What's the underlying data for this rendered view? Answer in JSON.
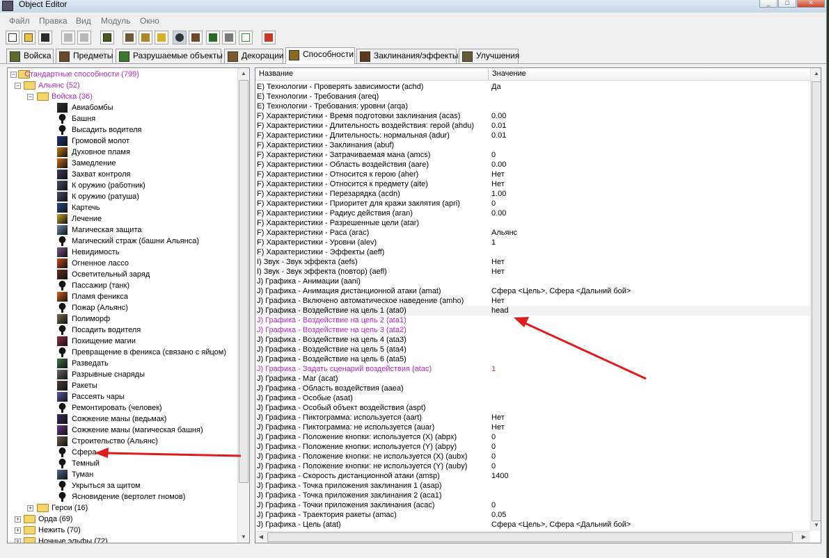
{
  "window": {
    "title": "Object Editor"
  },
  "menu": [
    "Файл",
    "Правка",
    "Вид",
    "Модуль",
    "Окно"
  ],
  "toolbar_icons": [
    "new-file-icon",
    "open-folder-icon",
    "save-icon",
    "copy-icon",
    "paste-icon",
    "unit-icon",
    "doodad-icon",
    "item-icon",
    "sound-icon",
    "ability-icon",
    "upgrade-icon",
    "terrain-icon",
    "object-icon",
    "export-icon",
    "test-map-icon"
  ],
  "tabs": [
    {
      "label": "Войска",
      "icon_color": "#5a6f2a"
    },
    {
      "label": "Предметы",
      "icon_color": "#6b4a2a"
    },
    {
      "label": "Разрушаемые объекты",
      "icon_color": "#3a7a2a"
    },
    {
      "label": "Декорации",
      "icon_color": "#7a5a2a"
    },
    {
      "label": "Способности",
      "icon_color": "#8a6a20",
      "active": true
    },
    {
      "label": "Заклинания/эффекты",
      "icon_color": "#5a3a1a"
    },
    {
      "label": "Улучшения",
      "icon_color": "#6a5a3a"
    }
  ],
  "tree": {
    "root": {
      "label": "Стандартные способности (799)",
      "color": "#b02cc3"
    },
    "alliance": {
      "label": "Альянс (52)",
      "color": "#b02cc3"
    },
    "units_folder": {
      "label": "Войска (36)",
      "color": "#b02cc3"
    },
    "items": [
      {
        "label": "Авиабомбы",
        "icon": "bomb-icon",
        "color": "#333"
      },
      {
        "label": "Башня",
        "icon": "key-icon"
      },
      {
        "label": "Высадить водителя",
        "icon": "key-icon"
      },
      {
        "label": "Громовой молот",
        "icon": "hammer-icon",
        "color": "#1d3a7a"
      },
      {
        "label": "Духовное пламя",
        "icon": "flame-icon",
        "color": "#c47a1a"
      },
      {
        "label": "Замедление",
        "icon": "slow-icon",
        "color": "#d66a1a"
      },
      {
        "label": "Захват контроля",
        "icon": "control-icon",
        "color": "#3a3a5a"
      },
      {
        "label": "К оружию (работник)",
        "icon": "arms-icon",
        "color": "#4a4a6a"
      },
      {
        "label": "К оружию (ратуша)",
        "icon": "arms-icon",
        "color": "#4a4a6a"
      },
      {
        "label": "Картечь",
        "icon": "shot-icon",
        "color": "#2a4a8a"
      },
      {
        "label": "Лечение",
        "icon": "heal-icon",
        "color": "#c9a02a"
      },
      {
        "label": "Магическая защита",
        "icon": "shield-icon",
        "color": "#6a8aa8"
      },
      {
        "label": "Магический страж (башни Альянса)",
        "icon": "key-icon"
      },
      {
        "label": "Невидимость",
        "icon": "invis-icon",
        "color": "#7a5a8a"
      },
      {
        "label": "Огненное лассо",
        "icon": "lasso-icon",
        "color": "#c44a1a"
      },
      {
        "label": "Осветительный заряд",
        "icon": "flare-icon",
        "color": "#6a2a1a"
      },
      {
        "label": "Пассажир (танк)",
        "icon": "key-icon"
      },
      {
        "label": "Пламя феникса",
        "icon": "phoenix-icon",
        "color": "#d4621a"
      },
      {
        "label": "Пожар (Альянс)",
        "icon": "key-icon"
      },
      {
        "label": "Полиморф",
        "icon": "polymorph-icon",
        "color": "#7a6a4a"
      },
      {
        "label": "Посадить водителя",
        "icon": "key-icon"
      },
      {
        "label": "Похищение магии",
        "icon": "steal-icon",
        "color": "#9a2a4a"
      },
      {
        "label": "Превращение в феникса (связано с яйцом)",
        "icon": "key-icon"
      },
      {
        "label": "Разведать",
        "icon": "scout-icon",
        "color": "#3a7a4a"
      },
      {
        "label": "Разрывные снаряды",
        "icon": "shell-icon",
        "color": "#6a6a6a"
      },
      {
        "label": "Ракеты",
        "icon": "rocket-icon",
        "color": "#4a3a3a"
      },
      {
        "label": "Рассеять чары",
        "icon": "dispel-icon",
        "color": "#5a5aaa"
      },
      {
        "label": "Ремонтировать (человек)",
        "icon": "key-icon"
      },
      {
        "label": "Сожжение маны (ведьмак)",
        "icon": "manaburn-icon",
        "color": "#3a2a6a"
      },
      {
        "label": "Сожжение маны (магическая башня)",
        "icon": "manaburn-icon",
        "color": "#6a3a8a"
      },
      {
        "label": "Строительство (Альянс)",
        "icon": "build-icon",
        "color": "#6a5a4a"
      },
      {
        "label": "Сфера",
        "icon": "key-icon"
      },
      {
        "label": "Темный",
        "icon": "key-icon"
      },
      {
        "label": "Туман",
        "icon": "fog-icon",
        "color": "#4a6a8a"
      },
      {
        "label": "Укрыться за щитом",
        "icon": "key-icon"
      },
      {
        "label": "Ясновидение (вертолет гномов)",
        "icon": "key-icon"
      }
    ],
    "heroes": {
      "label": "Герои (16)"
    },
    "others": [
      {
        "label": "Орда (69)"
      },
      {
        "label": "Нежить (70)"
      },
      {
        "label": "Ночные эльфы (72)"
      }
    ]
  },
  "table": {
    "col_name": "Название",
    "col_value": "Значение",
    "rows": [
      {
        "name": "E) Технологии - Проверять зависимости (achd)",
        "value": "Да"
      },
      {
        "name": "E) Технологии - Требования (areq)",
        "value": ""
      },
      {
        "name": "E) Технологии - Требования: уровни (arqa)",
        "value": ""
      },
      {
        "name": "F) Характеристики - Время подготовки заклинания (acas)",
        "value": "0.00"
      },
      {
        "name": "F) Характеристики - Длительность воздействия: герой (ahdu)",
        "value": "0.01"
      },
      {
        "name": "F) Характеристики - Длительность: нормальная (adur)",
        "value": "0.01"
      },
      {
        "name": "F) Характеристики - Заклинания (abuf)",
        "value": ""
      },
      {
        "name": "F) Характеристики - Затрачиваемая мана (amcs)",
        "value": "0"
      },
      {
        "name": "F) Характеристики - Область воздействия (aare)",
        "value": "0.00"
      },
      {
        "name": "F) Характеристики - Относится к герою (aher)",
        "value": "Нет"
      },
      {
        "name": "F) Характеристики - Относится к предмету (aite)",
        "value": "Нет"
      },
      {
        "name": "F) Характеристики - Перезарядка (acdn)",
        "value": "1.00"
      },
      {
        "name": "F) Характеристики - Приоритет для кражи заклятия (apri)",
        "value": "0"
      },
      {
        "name": "F) Характеристики - Радиус действия (aran)",
        "value": "0.00"
      },
      {
        "name": "F) Характеристики - Разрешенные цели (atar)",
        "value": ""
      },
      {
        "name": "F) Характеристики - Раса (arac)",
        "value": "Альянс"
      },
      {
        "name": "F) Характеристики - Уровни (alev)",
        "value": "1"
      },
      {
        "name": "F) Характеристики - Эффекты (aeff)",
        "value": ""
      },
      {
        "name": "I) Звук - Звук эффекта (aefs)",
        "value": "Нет"
      },
      {
        "name": "I) Звук - Звук эффекта (повтор) (aefl)",
        "value": "Нет"
      },
      {
        "name": "J) Графика - Анимации (aani)",
        "value": ""
      },
      {
        "name": "J) Графика - Анимация дистанционной атаки (amat)",
        "value": "Сфера <Цель>, Сфера <Дальний бой>"
      },
      {
        "name": "J) Графика - Включено автоматическое наведение (amho)",
        "value": "Нет"
      },
      {
        "name": "J) Графика - Воздействие на цель 1 (ata0)",
        "value": "head",
        "selected": true
      },
      {
        "name": "J) Графика - Воздействие на цель 2 (ata1)",
        "value": "",
        "modified": true
      },
      {
        "name": "J) Графика - Воздействие на цель 3 (ata2)",
        "value": "",
        "modified": true
      },
      {
        "name": "J) Графика - Воздействие на цель 4 (ata3)",
        "value": ""
      },
      {
        "name": "J) Графика - Воздействие на цель 5 (ata4)",
        "value": ""
      },
      {
        "name": "J) Графика - Воздействие на цель 6 (ata5)",
        "value": ""
      },
      {
        "name": "J) Графика - Задать сценарий воздействия (atac)",
        "value": "1",
        "modified": true
      },
      {
        "name": "J) Графика - Маг (acat)",
        "value": ""
      },
      {
        "name": "J) Графика - Область воздействия (aaea)",
        "value": ""
      },
      {
        "name": "J) Графика - Особые (asat)",
        "value": ""
      },
      {
        "name": "J) Графика - Особый объект воздействия (aspt)",
        "value": ""
      },
      {
        "name": "J) Графика - Пиктограмма: используется (aart)",
        "value": "Нет"
      },
      {
        "name": "J) Графика - Пиктограмма: не используется (auar)",
        "value": "Нет"
      },
      {
        "name": "J) Графика - Положение кнопки: используется (X) (abpx)",
        "value": "0"
      },
      {
        "name": "J) Графика - Положение кнопки: используется (Y) (abpy)",
        "value": "0"
      },
      {
        "name": "J) Графика - Положение кнопки: не используется (X) (aubx)",
        "value": "0"
      },
      {
        "name": "J) Графика - Положение кнопки: не используется (Y) (auby)",
        "value": "0"
      },
      {
        "name": "J) Графика - Скорость дистанционной атаки (amsp)",
        "value": "1400"
      },
      {
        "name": "J) Графика - Точка приложения заклинания 1 (asap)",
        "value": ""
      },
      {
        "name": "J) Графика - Точка приложения заклинания 2 (aca1)",
        "value": ""
      },
      {
        "name": "J) Графика - Точки приложения заклинания (acac)",
        "value": "0"
      },
      {
        "name": "J) Графика - Траектория ракеты (amac)",
        "value": "0.05"
      },
      {
        "name": "J) Графика - Цель (atat)",
        "value": "Сфера <Цель>, Сфера <Дальний бой>"
      }
    ]
  },
  "colors": {
    "modified": "#b02cc3",
    "annotation_arrow": "#e11b1b"
  }
}
